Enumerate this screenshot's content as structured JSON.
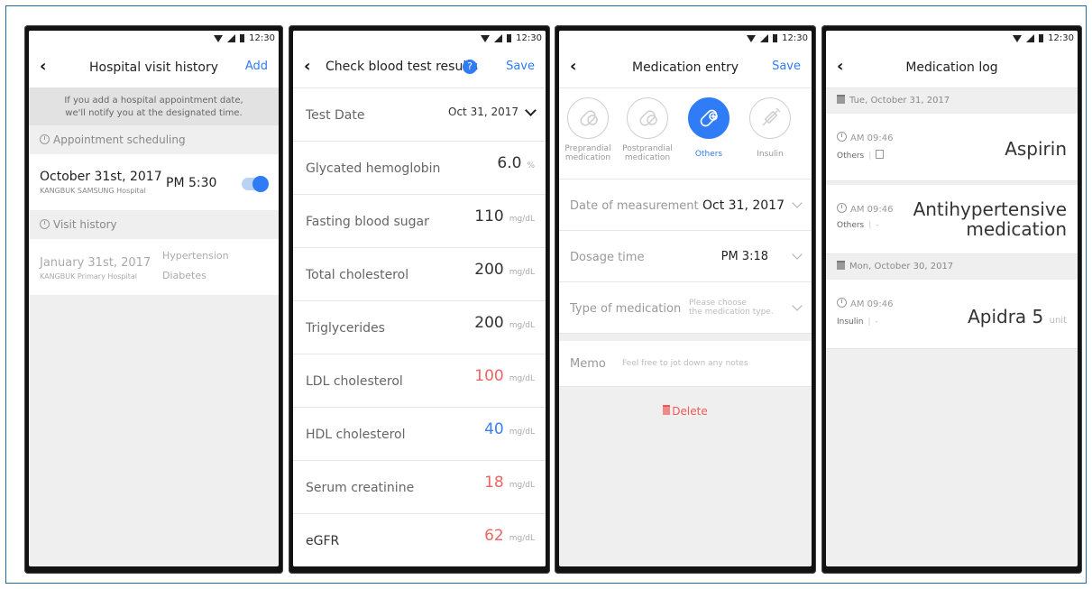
{
  "status_time": "12:30",
  "screens": {
    "visit_history": {
      "title": "Hospital visit history",
      "action": "Add",
      "notice_line1": "If you add a hospital appointment date,",
      "notice_line2": "we'll notify you at the designated time.",
      "appointment_section": "Appointment scheduling",
      "appointment": {
        "date": "October 31st, 2017",
        "hospital": "KANGBUK SAMSUNG Hospital",
        "time": "PM 5:30",
        "alarm_on": true
      },
      "history_section": "Visit history",
      "visit": {
        "date": "January 31st, 2017",
        "hospital": "KANGBUK Primary Hospital",
        "condition1": "Hypertension",
        "condition2": "Diabetes"
      }
    },
    "blood_test": {
      "title": "Check blood test results",
      "help": "?",
      "action": "Save",
      "test_date_label": "Test Date",
      "test_date_value": "Oct 31, 2017",
      "rows": [
        {
          "label": "Glycated hemoglobin",
          "value": "6.0",
          "unit": "%",
          "color": "#333333"
        },
        {
          "label": "Fasting blood sugar",
          "value": "110",
          "unit": "mg/dL",
          "color": "#333333"
        },
        {
          "label": "Total cholesterol",
          "value": "200",
          "unit": "mg/dL",
          "color": "#333333"
        },
        {
          "label": "Triglycerides",
          "value": "200",
          "unit": "mg/dL",
          "color": "#333333"
        },
        {
          "label": "LDL cholesterol",
          "value": "100",
          "unit": "mg/dL",
          "color": "#f06464"
        },
        {
          "label": "HDL cholesterol",
          "value": "40",
          "unit": "mg/dL",
          "color": "#3a7ff0"
        },
        {
          "label": "Serum creatinine",
          "value": "18",
          "unit": "mg/dL",
          "color": "#f06464"
        },
        {
          "label": "eGFR",
          "value": "62",
          "unit": "mg/dL",
          "color": "#f06464"
        }
      ]
    },
    "medication_entry": {
      "title": "Medication entry",
      "action": "Save",
      "types": [
        {
          "label1": "Preprandial",
          "label2": "medication",
          "active": false,
          "icon": "pill-icon"
        },
        {
          "label1": "Postprandial",
          "label2": "medication",
          "active": false,
          "icon": "pill-icon"
        },
        {
          "label1": "Others",
          "label2": "",
          "active": true,
          "icon": "capsule-plus-icon"
        },
        {
          "label1": "Insulin",
          "label2": "",
          "active": false,
          "icon": "syringe-icon"
        }
      ],
      "date_label": "Date of measurement",
      "date_value": "Oct 31, 2017",
      "dosage_label": "Dosage time",
      "dosage_value": "PM 3:18",
      "type_label": "Type of medication",
      "type_placeholder1": "Please choose",
      "type_placeholder2": "the medication type.",
      "memo_label": "Memo",
      "memo_placeholder": "Feel free to jot down any notes",
      "delete_label": "Delete"
    },
    "medication_log": {
      "title": "Medication log",
      "day1": "Tue, October 31, 2017",
      "entries_day1": [
        {
          "time": "AM 09:46",
          "type": "Others",
          "extra": "",
          "name1": "Aspirin",
          "name2": ""
        },
        {
          "time": "AM 09:46",
          "type": "Others",
          "extra": "-",
          "name1": "Antihypertensive",
          "name2": "medication"
        }
      ],
      "day2": "Mon, October 30, 2017",
      "entries_day2": [
        {
          "time": "AM 09:46",
          "type": "Insulin",
          "extra": "-",
          "name1": "Apidra 5",
          "unit": "unit"
        }
      ]
    }
  }
}
